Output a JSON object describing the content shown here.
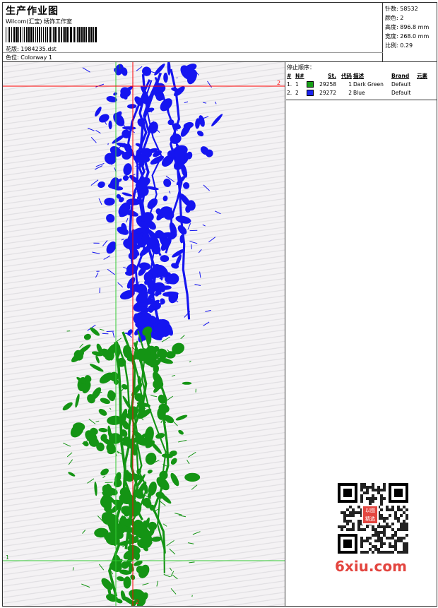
{
  "header": {
    "title": "生产作业图",
    "studio": "Wilcom(汇宝) 绣饰工作室",
    "design": "花版: 1984235.dst",
    "colorway": "色位: Colorway 1"
  },
  "stats": {
    "stitches": "针数: 58532",
    "colors": "颜色: 2",
    "height": "高度: 896.8 mm",
    "width": "宽度: 268.0 mm",
    "scale": "比例: 0.29"
  },
  "canvas": {
    "hline_top_label": "2",
    "hline_bottom_label": "1",
    "vline_green_label": "1",
    "vline_red_label": "2",
    "colors": {
      "green_line": "#33cc33",
      "red_line": "#ff0000",
      "blue_fill": "#1515f0",
      "green_fill": "#149414"
    }
  },
  "panel": {
    "stop_title": "停止顺序：",
    "columns": [
      "#",
      "N#",
      "",
      "St.",
      "代码",
      "描述",
      "Brand",
      "元素"
    ],
    "rows": [
      {
        "idx": "1.",
        "n": "1",
        "color": "#17a017",
        "st": "29258",
        "code": "1",
        "desc": "Dark Green",
        "brand": "Default",
        "elem": ""
      },
      {
        "idx": "2.",
        "n": "2",
        "color": "#1a22f0",
        "st": "29272",
        "code": "2",
        "desc": "Blue",
        "brand": "Default",
        "elem": ""
      }
    ]
  },
  "watermark": {
    "stamp": "以图精选",
    "site": "6xiu.com"
  }
}
